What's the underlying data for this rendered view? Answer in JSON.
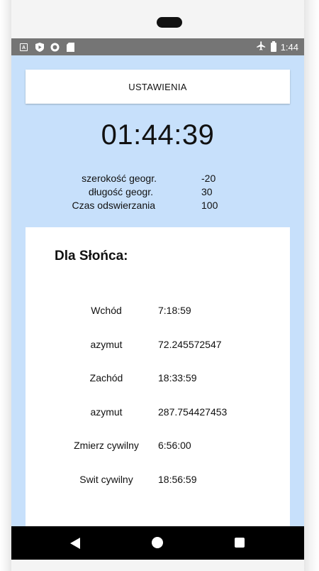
{
  "status_bar": {
    "time": "1:44",
    "left_icons": [
      "a-icon",
      "play-protect-icon",
      "circle-icon",
      "sd-card-icon"
    ],
    "right_icons": [
      "airplane-icon",
      "battery-icon"
    ]
  },
  "header": {
    "settings_label": "USTAWIENIA"
  },
  "clock": {
    "time": "01:44:39"
  },
  "params": [
    {
      "label": "szerokość geogr.",
      "value": "-20"
    },
    {
      "label": "długość geogr.",
      "value": "30"
    },
    {
      "label": "Czas odswierzania",
      "value": "100"
    }
  ],
  "sun": {
    "title": "Dla Słońca:",
    "rows": [
      {
        "label": "Wchód",
        "value": "7:18:59"
      },
      {
        "label": "azymut",
        "value": "72.245572547"
      },
      {
        "label": "Zachód",
        "value": "18:33:59"
      },
      {
        "label": "azymut",
        "value": "287.754427453"
      },
      {
        "label": "Zmierz cywilny",
        "value": "6:56:00"
      },
      {
        "label": "Swit cywilny",
        "value": "18:56:59"
      }
    ]
  },
  "colors": {
    "screen_bg": "#c7e0fb",
    "status_bar": "#757575",
    "nav_bar": "#000000",
    "card": "#ffffff"
  }
}
